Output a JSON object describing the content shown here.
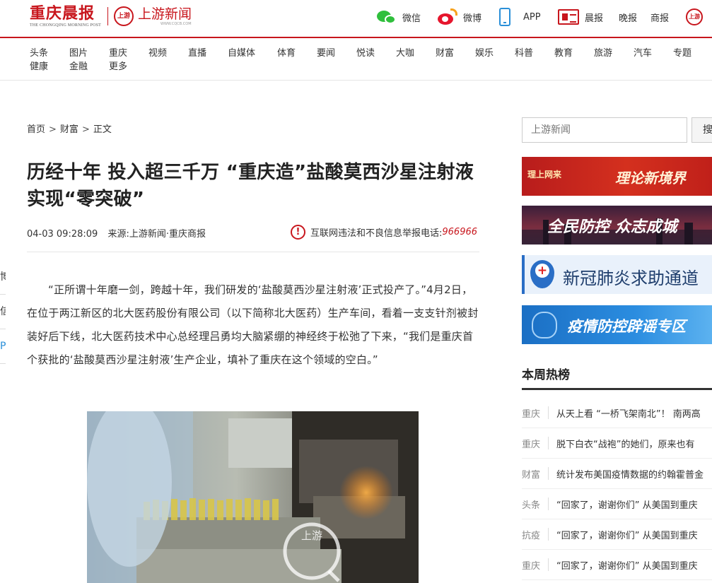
{
  "header": {
    "logo_main": "重庆晨报",
    "logo_sub": "THE CHONGQING MORNING POST",
    "logo2_name": "上游新闻",
    "logo2_mark": "上游",
    "logo2_url": "WWW.CQCB.COM",
    "nav": [
      {
        "label": "微信",
        "icon": "wechat-icon"
      },
      {
        "label": "微博",
        "icon": "weibo-icon"
      },
      {
        "label": "APP",
        "icon": "phone-icon"
      },
      {
        "label": "晨报",
        "icon": "newspaper-icon"
      },
      {
        "label": "晚报"
      },
      {
        "label": "商报"
      }
    ],
    "end_icon_mark": "上游"
  },
  "channels": [
    "头条",
    "图片",
    "重庆",
    "视频",
    "直播",
    "自媒体",
    "体育",
    "要闻",
    "悦读",
    "大咖",
    "财富",
    "娱乐",
    "科普",
    "教育",
    "旅游",
    "汽车",
    "专题",
    "健康",
    "金融",
    "更多"
  ],
  "left_edge": [
    "博",
    "信",
    "P"
  ],
  "breadcrumb": {
    "home": "首页",
    "section": "财富",
    "current": "正文",
    "separator": ">"
  },
  "article": {
    "title": "历经十年 投入超三千万 “重庆造”盐酸莫西沙星注射液实现“零突破”",
    "time": "04-03 09:28:09",
    "source": "来源:上游新闻·重庆商报",
    "report_label": "互联网违法和不良信息举报电话:",
    "report_phone": "966966",
    "paragraph": "“正所谓十年磨一剑，跨越十年，我们研发的‘盐酸莫西沙星注射液’正式投产了。”4月2日，在位于两江新区的北大医药股份有限公司（以下简称北大医药）生产车间，看着一支支针剂被封装好后下线，北大医药技术中心总经理吕勇均大脑紧绷的神经终于松弛了下来，“我们是重庆首个获批的‘盐酸莫西沙星注射液’生产企业，填补了重庆在这个领域的空白。”",
    "photo_watermark": "上游"
  },
  "sidebar": {
    "search_placeholder": "上游新闻",
    "search_button": "搜",
    "banners": [
      {
        "text": "理论新境界",
        "logo_text": "理上网来"
      },
      {
        "text": "全民防控 众志成城"
      },
      {
        "text": "新冠肺炎求助通道"
      },
      {
        "text": "疫情防控辟谣专区"
      }
    ],
    "hot_title": "本周热榜",
    "hot_items": [
      {
        "tag": "重庆",
        "text": "从天上看 “一桥飞架南北”！ 南两高"
      },
      {
        "tag": "重庆",
        "text": "脱下白衣“战袍”的她们，原来也有"
      },
      {
        "tag": "财富",
        "text": "统计发布美国疫情数据的约翰霍普金"
      },
      {
        "tag": "头条",
        "text": "“回家了，谢谢你们” 从美国到重庆"
      },
      {
        "tag": "抗疫",
        "text": "“回家了，谢谢你们” 从美国到重庆"
      },
      {
        "tag": "重庆",
        "text": "“回家了，谢谢你们” 从美国到重庆"
      }
    ]
  },
  "colors": {
    "brand_red": "#c8161d",
    "wechat_green": "#2fbf3c",
    "app_blue": "#2a8fd8"
  }
}
